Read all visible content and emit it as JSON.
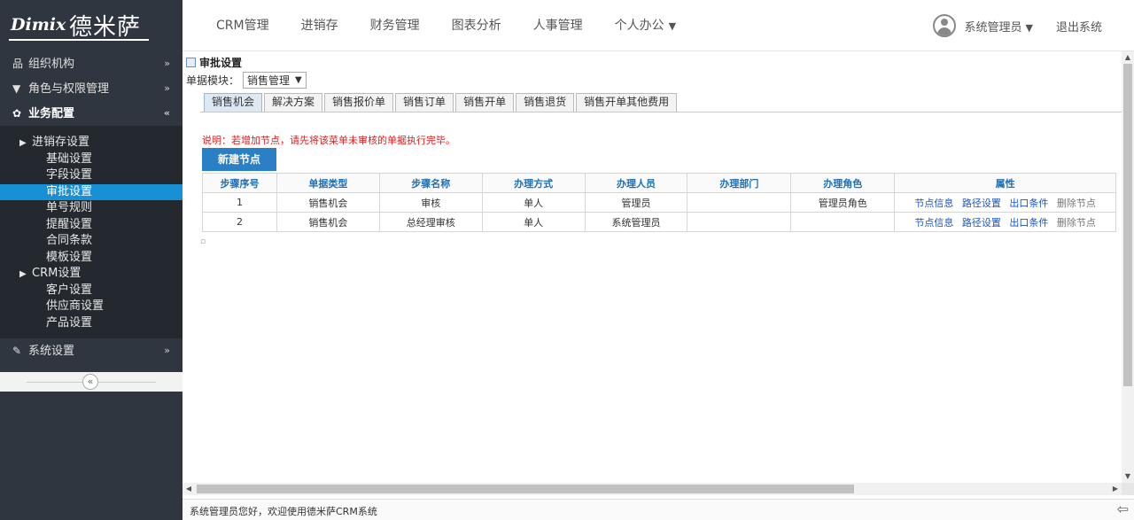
{
  "brand": {
    "name_en": "Dimix",
    "name_cn": "德米萨"
  },
  "topnav": {
    "items": [
      "CRM管理",
      "进销存",
      "财务管理",
      "图表分析",
      "人事管理",
      "个人办公"
    ]
  },
  "user": {
    "name": "系统管理员",
    "logout": "退出系统"
  },
  "sidebar": {
    "groups": [
      {
        "label": "组织机构",
        "icon": "org-chart-icon"
      },
      {
        "label": "角色与权限管理",
        "icon": "pin-icon"
      },
      {
        "label": "业务配置",
        "icon": "gear-icon"
      },
      {
        "label": "系统设置",
        "icon": "wrench-icon"
      }
    ],
    "tree": {
      "folder1": "进销存设置",
      "items1": [
        "基础设置",
        "字段设置",
        "审批设置",
        "单号规则",
        "提醒设置",
        "合同条款",
        "模板设置"
      ],
      "folder2": "CRM设置",
      "items2": [
        "客户设置",
        "供应商设置",
        "产品设置"
      ]
    }
  },
  "page": {
    "title": "审批设置",
    "module_label": "单据模块：",
    "module_value": "销售管理",
    "tabs": [
      "销售机会",
      "解决方案",
      "销售报价单",
      "销售订单",
      "销售开单",
      "销售退货",
      "销售开单其他费用"
    ],
    "note": "说明：若增加节点，请先将该菜单未审核的单据执行完毕。",
    "new_button": "新建节点"
  },
  "table": {
    "headers": [
      "步骤序号",
      "单据类型",
      "步骤名称",
      "办理方式",
      "办理人员",
      "办理部门",
      "办理角色",
      "属性"
    ],
    "rows": [
      {
        "seq": "1",
        "doc_type": "销售机会",
        "step": "审核",
        "mode": "单人",
        "person": "管理员",
        "dept": "",
        "role": "管理员角色"
      },
      {
        "seq": "2",
        "doc_type": "销售机会",
        "step": "总经理审核",
        "mode": "单人",
        "person": "系统管理员",
        "dept": "",
        "role": ""
      }
    ],
    "actions": [
      "节点信息",
      "路径设置",
      "出口条件",
      "删除节点"
    ]
  },
  "status": {
    "message": "系统管理员您好，欢迎使用德米萨CRM系统"
  },
  "colors": {
    "sidebar_bg": "#2f3640",
    "selected": "#1890d6",
    "button": "#2b7fc4",
    "note": "#e31b1b",
    "link": "#1a56c8"
  }
}
